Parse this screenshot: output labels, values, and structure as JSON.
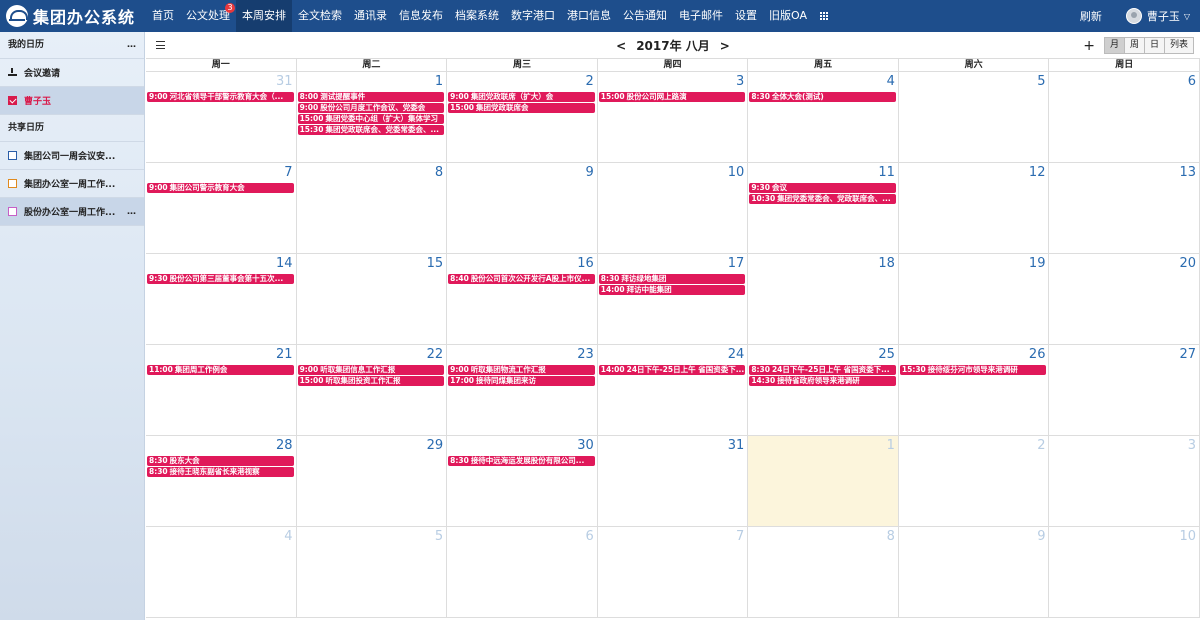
{
  "app": {
    "title": "集团办公系统"
  },
  "nav": [
    {
      "label": "首页"
    },
    {
      "label": "公文处理",
      "badge": "3"
    },
    {
      "label": "本周安排",
      "active": true
    },
    {
      "label": "全文检索"
    },
    {
      "label": "通讯录"
    },
    {
      "label": "信息发布"
    },
    {
      "label": "档案系统"
    },
    {
      "label": "数字港口"
    },
    {
      "label": "港口信息"
    },
    {
      "label": "公告通知"
    },
    {
      "label": "电子邮件"
    },
    {
      "label": "设置"
    },
    {
      "label": "旧版OA"
    }
  ],
  "user": {
    "refresh": "刷新",
    "name": "曹子玉"
  },
  "sidebar": {
    "my_calendar": "我的日历",
    "more": "…",
    "meeting_invite": "会议邀请",
    "mine": "曹子玉",
    "shared_calendar": "共享日历",
    "shared": [
      {
        "label": "集团公司一周会议安...",
        "color": "#2a5ea8"
      },
      {
        "label": "集团办公室一周工作...",
        "color": "#e08a1e"
      },
      {
        "label": "股份办公室一周工作...",
        "color": "#c65fc6"
      }
    ]
  },
  "calendar": {
    "title": "2017年 八月",
    "add": "+",
    "views": [
      "月",
      "周",
      "日",
      "列表"
    ],
    "weekdays": [
      "周一",
      "周二",
      "周三",
      "周四",
      "周五",
      "周六",
      "周日"
    ],
    "weeks": [
      [
        {
          "d": "31",
          "other": true,
          "events": [
            {
              "t": "9:00",
              "x": "河北省领导干部警示教育大会（..."
            }
          ]
        },
        {
          "d": "1",
          "events": [
            {
              "t": "8:00",
              "x": "测试提醒事件"
            },
            {
              "t": "9:00",
              "x": "股份公司月度工作会议、党委会"
            },
            {
              "t": "15:00",
              "x": "集团党委中心组（扩大）集体学习"
            },
            {
              "t": "15:30",
              "x": "集团党政联席会、党委常委会、..."
            }
          ]
        },
        {
          "d": "2",
          "events": [
            {
              "t": "9:00",
              "x": "集团党政联席（扩大）会"
            },
            {
              "t": "15:00",
              "x": "集团党政联席会"
            }
          ]
        },
        {
          "d": "3",
          "events": [
            {
              "t": "15:00",
              "x": "股份公司网上路演"
            }
          ]
        },
        {
          "d": "4",
          "events": [
            {
              "t": "8:30",
              "x": "全体大会(测试)"
            }
          ]
        },
        {
          "d": "5",
          "events": []
        },
        {
          "d": "6",
          "events": []
        }
      ],
      [
        {
          "d": "7",
          "events": [
            {
              "t": "9:00",
              "x": "集团公司警示教育大会"
            }
          ]
        },
        {
          "d": "8",
          "events": []
        },
        {
          "d": "9",
          "events": []
        },
        {
          "d": "10",
          "events": []
        },
        {
          "d": "11",
          "events": [
            {
              "t": "9:30",
              "x": "会议"
            },
            {
              "t": "10:30",
              "x": "集团党委常委会、党政联席会、..."
            }
          ]
        },
        {
          "d": "12",
          "events": []
        },
        {
          "d": "13",
          "events": []
        }
      ],
      [
        {
          "d": "14",
          "events": [
            {
              "t": "9:30",
              "x": "股份公司第三届董事会第十五次..."
            }
          ]
        },
        {
          "d": "15",
          "events": []
        },
        {
          "d": "16",
          "events": [
            {
              "t": "8:40",
              "x": "股份公司首次公开发行A股上市仪..."
            }
          ]
        },
        {
          "d": "17",
          "events": [
            {
              "t": "8:30",
              "x": "拜访绿地集团"
            },
            {
              "t": "14:00",
              "x": "拜访中能集团"
            }
          ]
        },
        {
          "d": "18",
          "events": []
        },
        {
          "d": "19",
          "events": []
        },
        {
          "d": "20",
          "events": []
        }
      ],
      [
        {
          "d": "21",
          "events": [
            {
              "t": "11:00",
              "x": "集团周工作例会"
            }
          ]
        },
        {
          "d": "22",
          "events": [
            {
              "t": "9:00",
              "x": "听取集团信息工作汇报"
            },
            {
              "t": "15:00",
              "x": "听取集团投资工作汇报"
            }
          ]
        },
        {
          "d": "23",
          "events": [
            {
              "t": "9:00",
              "x": "听取集团物流工作汇报"
            },
            {
              "t": "17:00",
              "x": "接待同煤集团来访"
            }
          ]
        },
        {
          "d": "24",
          "events": [
            {
              "t": "14:00",
              "x": "24日下午-25日上午 省国资委下..."
            }
          ]
        },
        {
          "d": "25",
          "events": [
            {
              "t": "8:30",
              "x": "24日下午-25日上午 省国资委下..."
            },
            {
              "t": "14:30",
              "x": "接待省政府领导来港调研"
            }
          ]
        },
        {
          "d": "26",
          "events": [
            {
              "t": "15:30",
              "x": "接待绥芬河市领导来港调研"
            }
          ]
        },
        {
          "d": "27",
          "events": []
        }
      ],
      [
        {
          "d": "28",
          "events": [
            {
              "t": "8:30",
              "x": "股东大会"
            },
            {
              "t": "8:30",
              "x": "接待王晓东副省长来港视察"
            }
          ]
        },
        {
          "d": "29",
          "events": []
        },
        {
          "d": "30",
          "events": [
            {
              "t": "8:30",
              "x": "接待中远海运发展股份有限公司..."
            }
          ]
        },
        {
          "d": "31",
          "events": []
        },
        {
          "d": "1",
          "other": true,
          "today": true,
          "events": []
        },
        {
          "d": "2",
          "other": true,
          "events": []
        },
        {
          "d": "3",
          "other": true,
          "events": []
        }
      ],
      [
        {
          "d": "4",
          "other": true,
          "events": []
        },
        {
          "d": "5",
          "other": true,
          "events": []
        },
        {
          "d": "6",
          "other": true,
          "events": []
        },
        {
          "d": "7",
          "other": true,
          "events": []
        },
        {
          "d": "8",
          "other": true,
          "events": []
        },
        {
          "d": "9",
          "other": true,
          "events": []
        },
        {
          "d": "10",
          "other": true,
          "events": []
        }
      ]
    ]
  }
}
